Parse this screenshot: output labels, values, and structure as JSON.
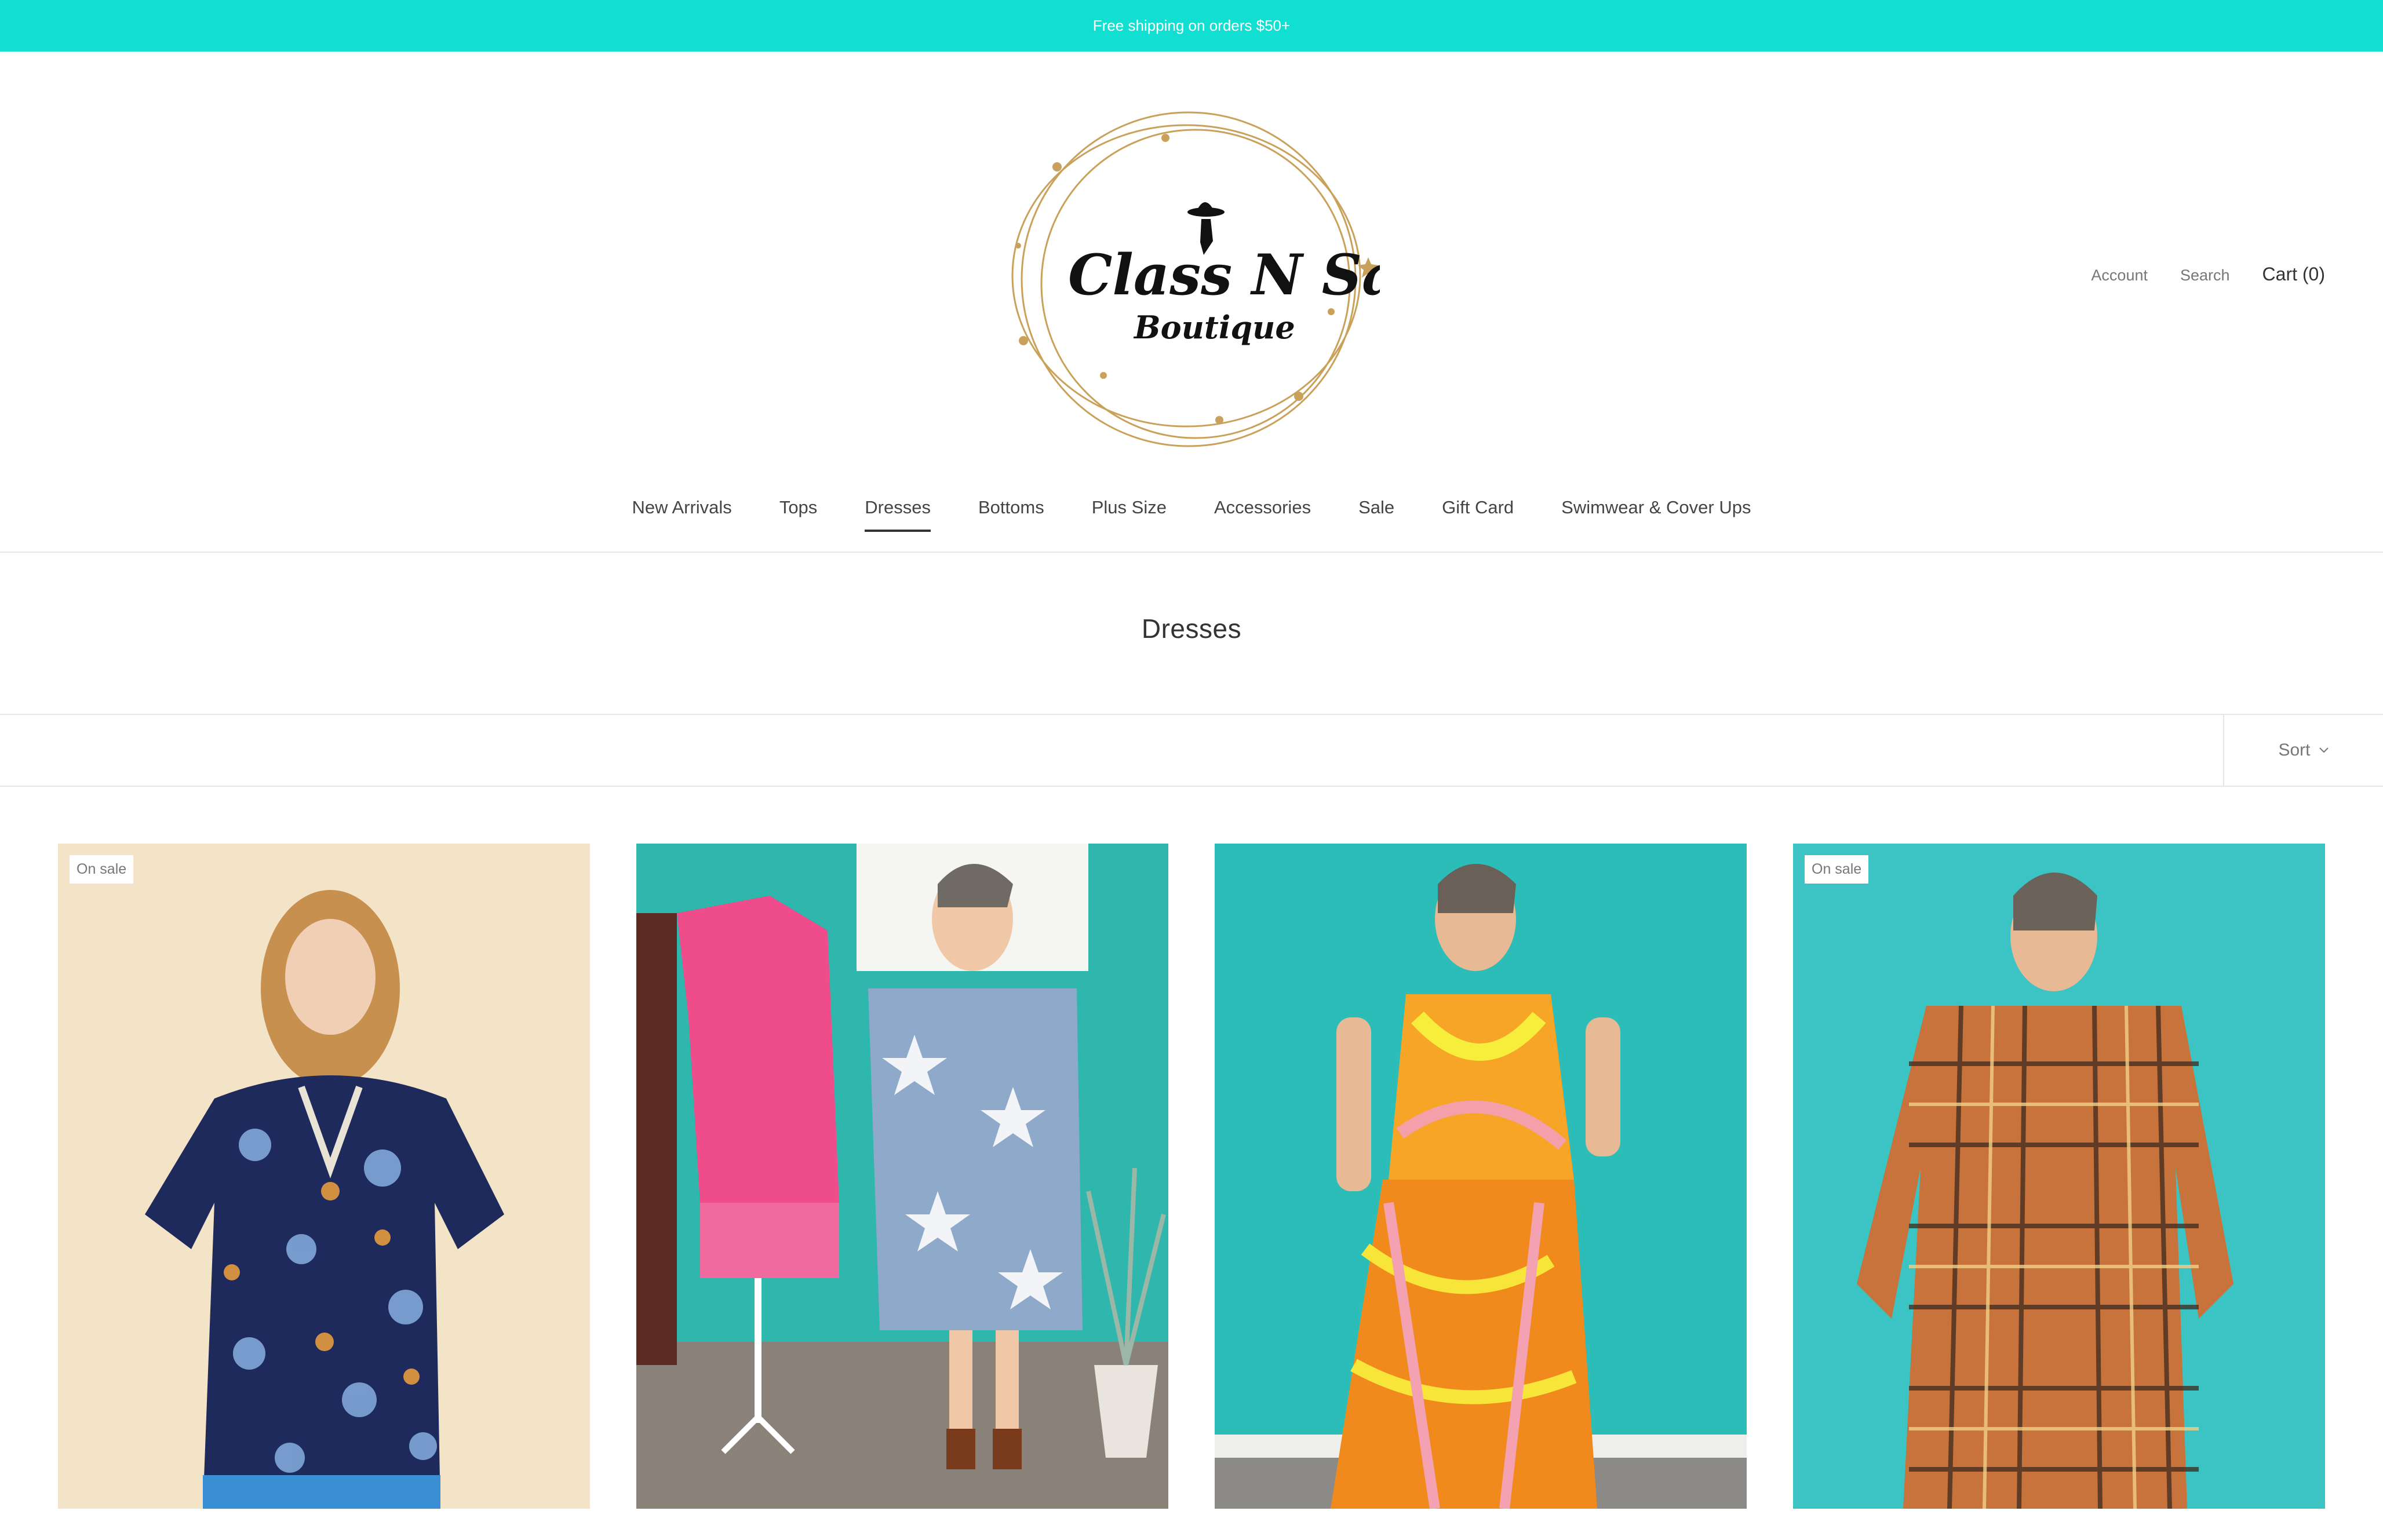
{
  "announcement": {
    "text": "Free shipping on orders $50+"
  },
  "brand": {
    "name_line1": "Class N Sass",
    "name_line2": "Boutique",
    "logo_colors": {
      "ring": "#c9a15a",
      "text": "#111111"
    }
  },
  "header": {
    "account_label": "Account",
    "search_label": "Search",
    "cart_label": "Cart (0)"
  },
  "nav": {
    "items": [
      {
        "label": "New Arrivals"
      },
      {
        "label": "Tops"
      },
      {
        "label": "Dresses",
        "active": true
      },
      {
        "label": "Bottoms"
      },
      {
        "label": "Plus Size"
      },
      {
        "label": "Accessories"
      },
      {
        "label": "Sale"
      },
      {
        "label": "Gift Card"
      },
      {
        "label": "Swimwear & Cover Ups"
      }
    ]
  },
  "collection": {
    "title": "Dresses",
    "sort_label": "Sort"
  },
  "products": [
    {
      "badge": "On sale",
      "image_desc": "navy floral v-neck dress",
      "title": ""
    },
    {
      "badge": "",
      "image_desc": "star print denim shirt dress and pink ruffle dress",
      "title": ""
    },
    {
      "badge": "",
      "image_desc": "orange and yellow printed cami and wide leg pant set",
      "title": ""
    },
    {
      "badge": "On sale",
      "image_desc": "orange plaid shirt dress",
      "title": ""
    }
  ],
  "colors": {
    "accent": "#10dfd2",
    "text_dark": "#333333",
    "text_muted": "#777777",
    "divider": "#e6e6e6"
  }
}
